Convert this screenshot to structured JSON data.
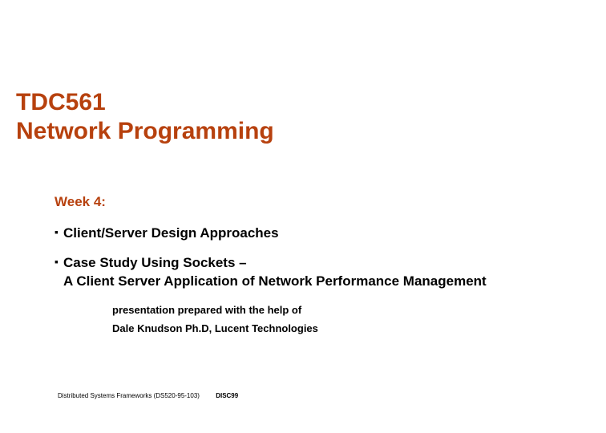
{
  "title_line1": "TDC561",
  "title_line2": "Network Programming",
  "week_label": "Week 4:",
  "bullets": [
    {
      "text": "Client/Server Design Approaches"
    },
    {
      "text_line1": "Case Study Using Sockets –",
      "text_line2": "A Client Server Application of Network Performance Management"
    }
  ],
  "credit_line1": "presentation prepared with the help of",
  "credit_line2": "Dale Knudson Ph.D,  Lucent Technologies",
  "footer_left": "Distributed Systems Frameworks (DS520-95-103)",
  "footer_right": "DISC99"
}
